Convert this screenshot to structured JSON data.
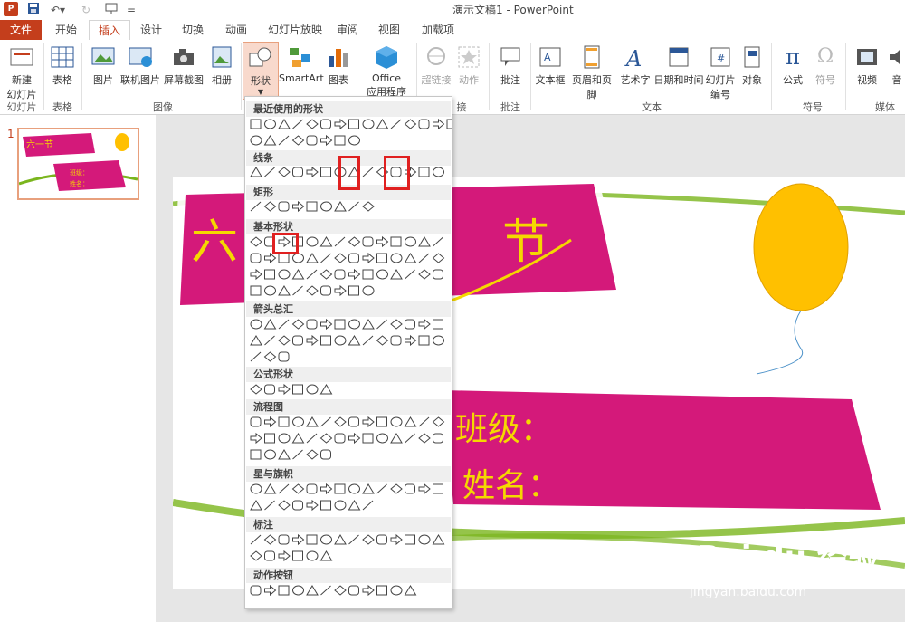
{
  "titlebar": {
    "app_icon": "P",
    "doc_title": "演示文稿1 - PowerPoint"
  },
  "tabs": [
    "文件",
    "开始",
    "插入",
    "设计",
    "切换",
    "动画",
    "幻灯片放映",
    "审阅",
    "视图",
    "加载项"
  ],
  "ribbon": {
    "new_slide": "新建",
    "new_slide2": "幻灯片",
    "table": "表格",
    "picture": "图片",
    "online_pic": "联机图片",
    "screenshot": "屏幕截图",
    "album": "相册",
    "shapes": "形状",
    "smartart": "SmartArt",
    "chart": "图表",
    "office_apps1": "Office",
    "office_apps2": "应用程序",
    "hyperlink": "超链接",
    "action": "动作",
    "comment": "批注",
    "textbox": "文本框",
    "header_footer": "页眉和页脚",
    "wordart": "艺术字",
    "datetime": "日期和时间",
    "slide_number1": "幻灯片",
    "slide_number2": "编号",
    "object": "对象",
    "equation": "公式",
    "symbol": "符号",
    "video": "视频",
    "audio": "音",
    "groups": {
      "slides": "幻灯片",
      "tables": "表格",
      "images": "图像",
      "links": "接",
      "comments": "批注",
      "text": "文本",
      "symbols": "符号",
      "media": "媒体"
    }
  },
  "slide_panel": {
    "number": "1"
  },
  "dropdown": {
    "sections": [
      "最近使用的形状",
      "线条",
      "矩形",
      "基本形状",
      "箭头总汇",
      "公式形状",
      "流程图",
      "星与旗帜",
      "标注",
      "动作按钮"
    ]
  },
  "slide": {
    "title_chars": "六一节",
    "class_label": "班级：",
    "name_label": "姓名："
  },
  "watermark": {
    "main": "Bai du 经验",
    "sub": "jingyan.baidu.com"
  },
  "colors": {
    "accent": "#c43e1c",
    "magenta": "#d4197a",
    "yellow": "#f5d800",
    "balloon": "#ffc000",
    "green": "#7ab51d"
  }
}
